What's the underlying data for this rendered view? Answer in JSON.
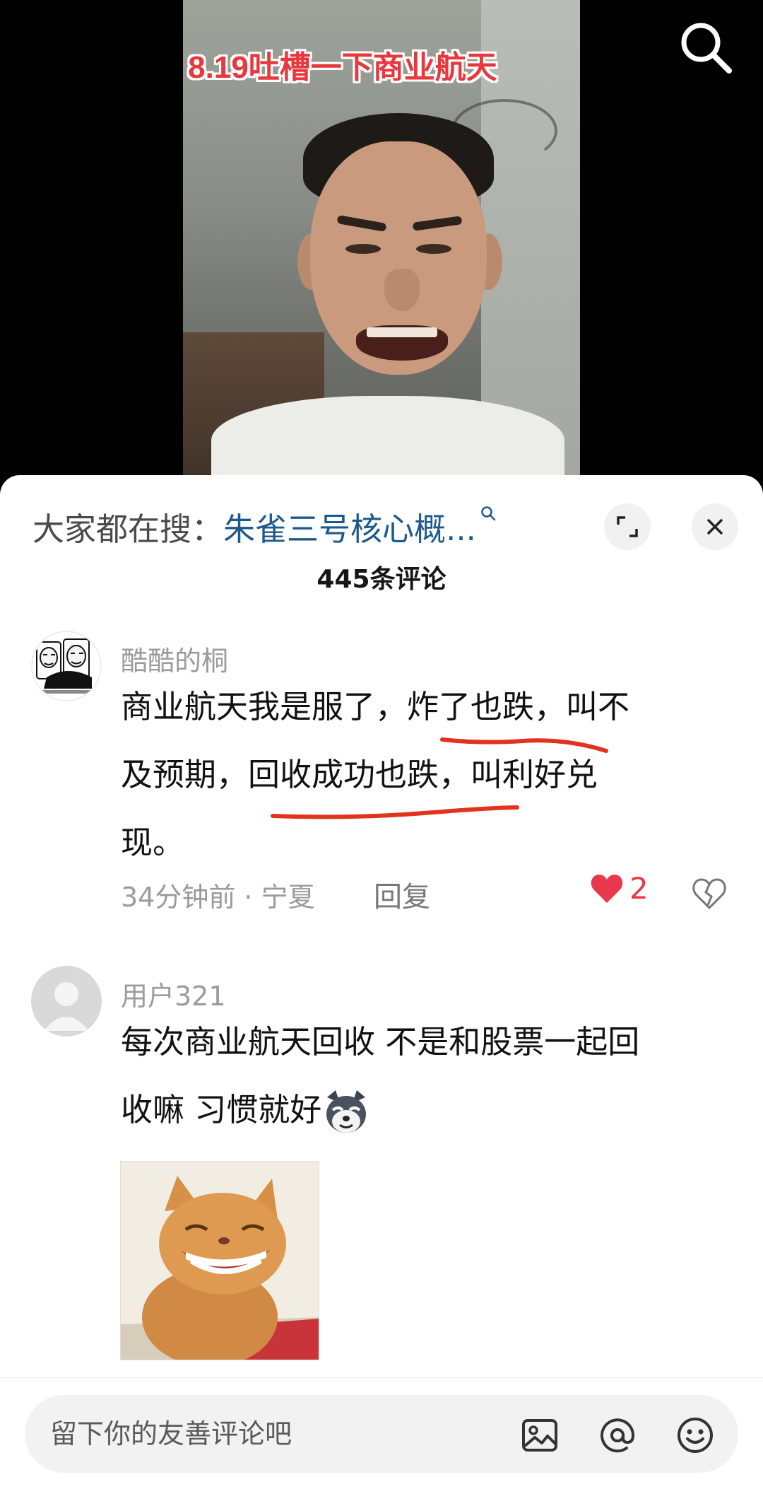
{
  "video": {
    "caption": "8.19吐槽一下商业航天",
    "icons": {
      "search": "search-icon"
    }
  },
  "sheet": {
    "hot_search": {
      "prefix": "大家都在搜：",
      "link": "朱雀三号核心概...",
      "mark": "Q"
    },
    "comment_count": "445条评论",
    "icons": {
      "expand": "expand-icon",
      "close": "close-icon"
    }
  },
  "comments": [
    {
      "username": "酷酷的桐",
      "text_lines": [
        "商业航天我是服了，炸了也跌，叫不",
        "及预期，回收成功也跌，叫利好兑",
        "现。"
      ],
      "time_location": "34分钟前 · 宁夏",
      "reply_label": "回复",
      "likes": "2",
      "liked": true,
      "annotation_color": "#e2331f"
    },
    {
      "username": "用户321",
      "text_lines": [
        "每次商业航天回收  不是和股票一起回",
        "收嘛 习惯就好"
      ],
      "inline_emoji": "husky-emoji",
      "image": "smiling-cat-image"
    }
  ],
  "input_bar": {
    "placeholder": "留下你的友善评论吧",
    "icons": [
      "image-icon",
      "at-icon",
      "emoji-icon"
    ]
  },
  "colors": {
    "accent_red": "#e8384b",
    "link_blue": "#1c5a8c",
    "caption_red": "#e8383d"
  }
}
